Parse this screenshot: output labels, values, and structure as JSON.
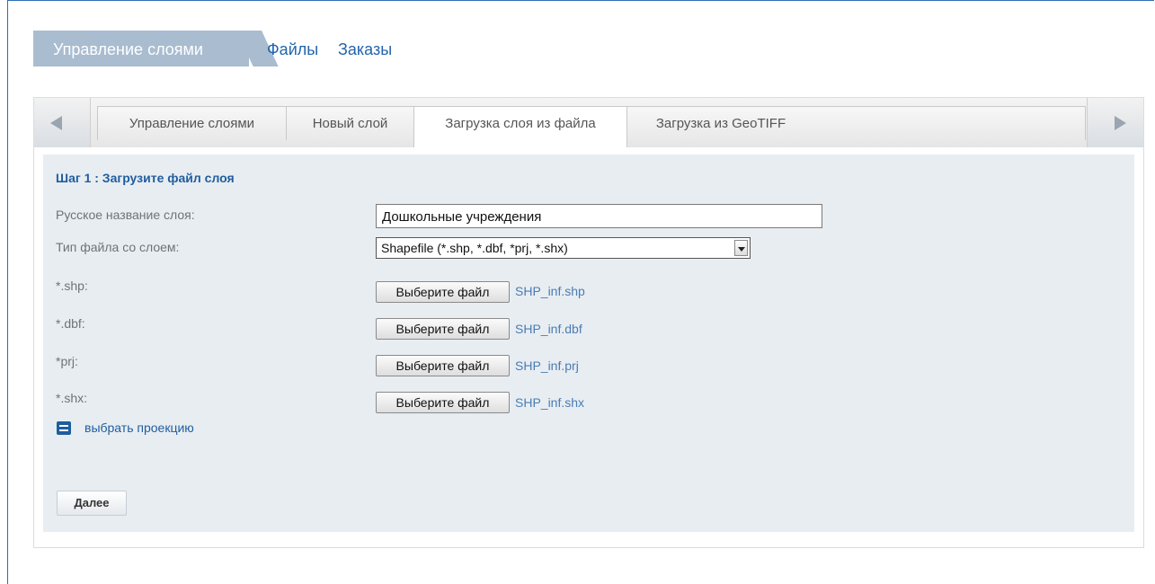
{
  "topnav": {
    "active": "Управление слоями",
    "files": "Файлы",
    "orders": "Заказы"
  },
  "tabs": [
    "Управление слоями",
    "Новый слой",
    "Загрузка слоя из файла",
    "Загрузка из GeoTIFF"
  ],
  "active_tab_index": 2,
  "form": {
    "step_title": "Шаг 1 : Загрузите файл слоя",
    "name_label": "Русское название слоя:",
    "name_value": "Дошкольные учреждения",
    "type_label": "Тип файла со слоем:",
    "type_value": "Shapefile (*.shp, *.dbf, *prj, *.shx)",
    "files": [
      {
        "label": "*.shp:",
        "button": "Выберите файл",
        "filename": "SHP_inf.shp"
      },
      {
        "label": "*.dbf:",
        "button": "Выберите файл",
        "filename": "SHP_inf.dbf"
      },
      {
        "label": "*prj:",
        "button": "Выберите файл",
        "filename": "SHP_inf.prj"
      },
      {
        "label": "*.shx:",
        "button": "Выберите файл",
        "filename": "SHP_inf.shx"
      }
    ],
    "projection_link": "выбрать проекцию",
    "next_button": "Далее"
  },
  "colors": {
    "accent": "#1f5d9e",
    "top_tab_bg": "#a9bcd0",
    "content_bg": "#e8edf2",
    "link": "#2265ad"
  },
  "icons": {
    "prev": "triangle-left-icon",
    "next": "triangle-right-icon",
    "projection": "list-icon"
  }
}
